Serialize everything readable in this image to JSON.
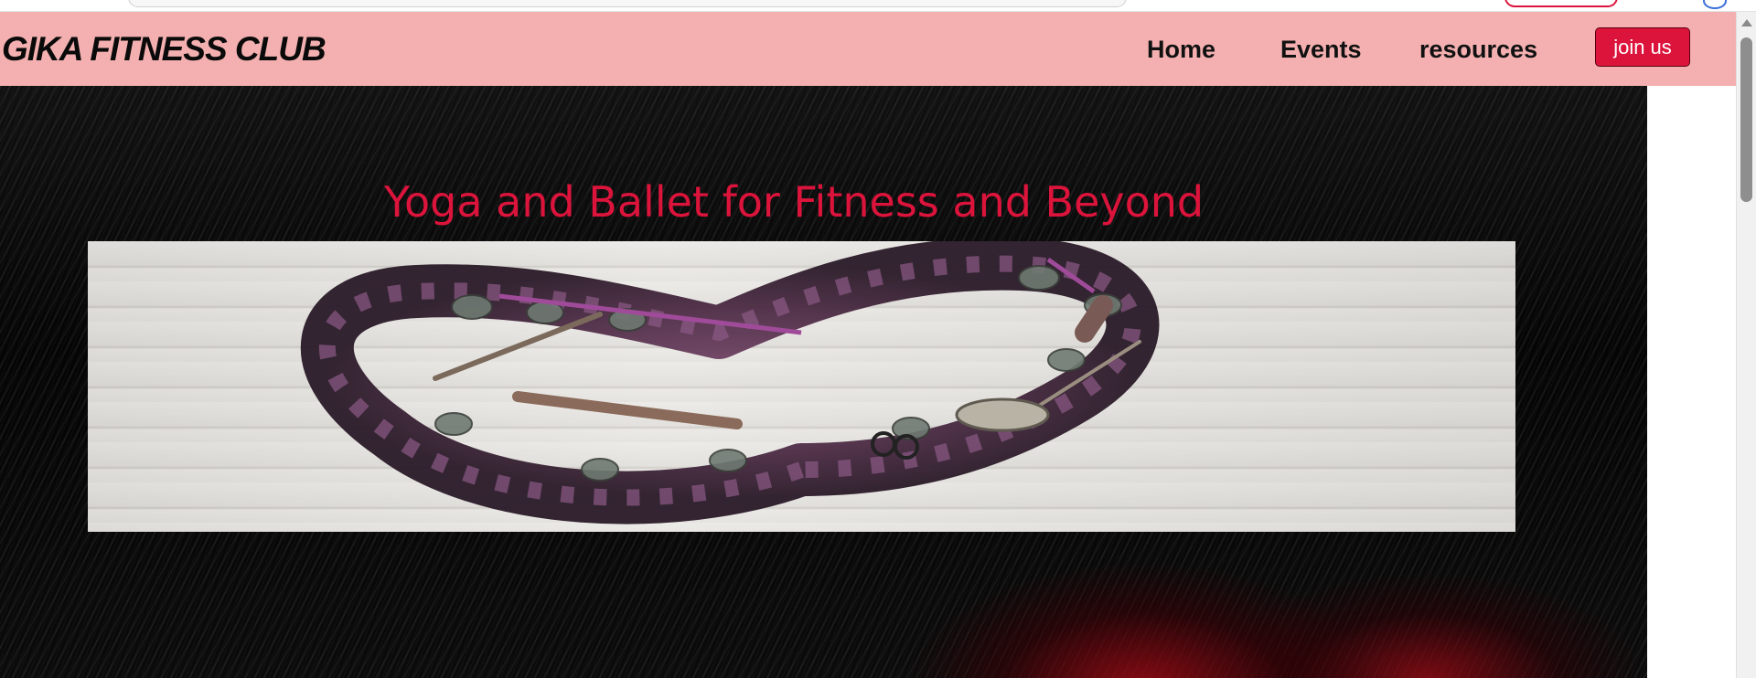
{
  "navbar": {
    "brand": "GIKA FITNESS CLUB",
    "links": [
      {
        "label": "Home"
      },
      {
        "label": "Events"
      },
      {
        "label": "resources"
      }
    ],
    "cta_label": "join us",
    "background_color": "#f4b0b0",
    "cta_color": "#dc143c"
  },
  "hero": {
    "title": "Yoga and Ballet for Fitness and Beyond",
    "title_color": "#dc143c",
    "image_icon": "heart-wreath-image"
  },
  "scrollbar": {
    "up_icon": "scroll-up-arrow-icon"
  }
}
